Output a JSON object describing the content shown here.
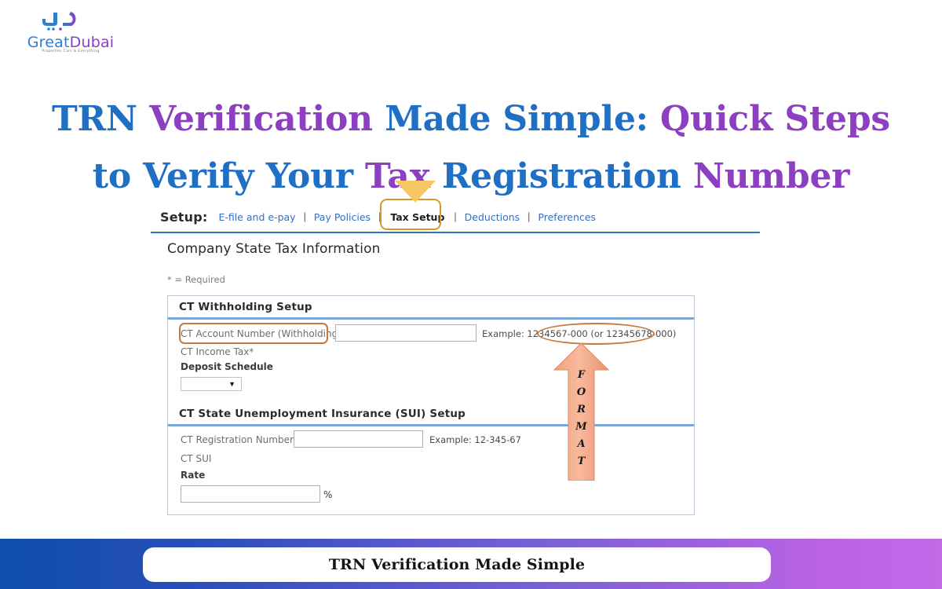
{
  "brand": {
    "name_first": "Great",
    "name_second": "Dubai",
    "tagline": "Properties Cars & Everything",
    "color_blue": "#2c7fd0",
    "color_purple": "#8b3fc4"
  },
  "headline": {
    "line1": [
      {
        "text": "TRN",
        "color": "blue"
      },
      {
        "text": "Verification",
        "color": "purple"
      },
      {
        "text": "Made",
        "color": "blue"
      },
      {
        "text": "Simple:",
        "color": "blue"
      },
      {
        "text": "Quick",
        "color": "purple"
      },
      {
        "text": "Steps",
        "color": "purple"
      }
    ],
    "line2": [
      {
        "text": "to",
        "color": "blue"
      },
      {
        "text": "Verify",
        "color": "blue"
      },
      {
        "text": "Your",
        "color": "blue"
      },
      {
        "text": "Tax",
        "color": "purple"
      },
      {
        "text": "Registration",
        "color": "blue"
      },
      {
        "text": "Number",
        "color": "purple"
      }
    ],
    "color_blue": "#1f6fc4",
    "color_purple": "#8c3fc0"
  },
  "screenshot": {
    "setup": {
      "label": "Setup:",
      "separator": "|",
      "links": [
        "E-file and e-pay",
        "Pay Policies",
        "Tax Setup",
        "Deductions",
        "Preferences"
      ],
      "active": "Tax Setup",
      "link_color": "#2f6fc4",
      "highlight_color": "#d49a2a",
      "pointer_color": "#f8c763"
    },
    "page_title": "Company State Tax Information",
    "required_note": "* = Required",
    "withholding": {
      "section_title": "CT Withholding Setup",
      "account_label": "CT Account Number (Withholding)",
      "account_value": "",
      "example": "Example: 1234567-000   (or 12345678-000)",
      "income_tax_label": "CT Income Tax*",
      "deposit_schedule_label": "Deposit Schedule",
      "deposit_schedule_value": "",
      "caret": "▼"
    },
    "sui": {
      "section_title": "CT State Unemployment Insurance (SUI) Setup",
      "registration_label": "CT Registration Number",
      "registration_value": "",
      "example": "Example: 12-345-67",
      "sui_label": "CT SUI",
      "rate_label": "Rate",
      "rate_value": "",
      "percent_sign": "%"
    },
    "annotation": {
      "format_letters": [
        "F",
        "O",
        "R",
        "M",
        "A",
        "T"
      ],
      "arrow_color": "#f0a580",
      "outline_color": "#c3793f"
    }
  },
  "footer": {
    "caption": "TRN Verification Made Simple",
    "gradient_start": "#0d4eae",
    "gradient_end": "#c06ae8"
  }
}
